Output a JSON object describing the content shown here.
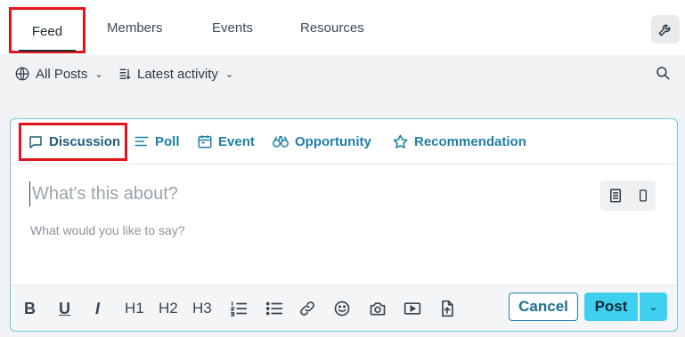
{
  "tabs": {
    "feed": "Feed",
    "members": "Members",
    "events": "Events",
    "resources": "Resources"
  },
  "filters": {
    "all_posts": "All Posts",
    "sort": "Latest activity"
  },
  "composer": {
    "types": {
      "discussion": "Discussion",
      "poll": "Poll",
      "event": "Event",
      "opportunity": "Opportunity",
      "recommendation": "Recommendation"
    },
    "title_placeholder": "What's this about?",
    "body_placeholder": "What would you like to say?"
  },
  "toolbar": {
    "bold": "B",
    "underline": "U",
    "italic": "I",
    "h1": "H1",
    "h2": "H2",
    "h3": "H3",
    "cancel": "Cancel",
    "post": "Post"
  },
  "colors": {
    "accent": "#1d7fa8",
    "post_button": "#3fd0ef",
    "highlight_box": "#e3131b"
  }
}
